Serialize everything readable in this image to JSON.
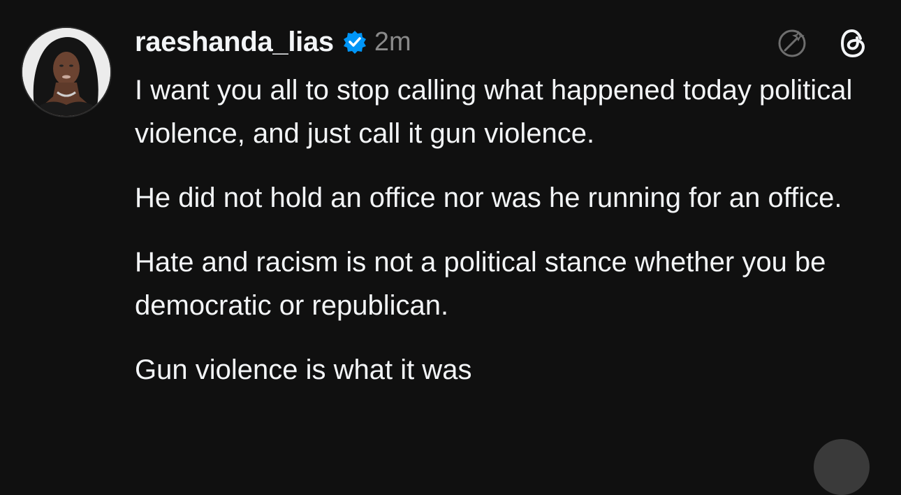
{
  "post": {
    "username": "raeshanda_lias",
    "timestamp": "2m",
    "verified_icon": "verified-badge-icon",
    "paragraphs": [
      "I want you all to stop calling what happened today political violence, and just call it gun violence.",
      "He did not hold an office nor was he running for an office.",
      "Hate and racism is not a political stance whether you be democratic or republican.",
      "Gun violence is what it was"
    ]
  },
  "icons": {
    "ai": "ai-edit-icon",
    "threads": "threads-logo-icon"
  },
  "colors": {
    "background": "#101010",
    "text": "#f3f5f7",
    "muted": "#8a8a8a",
    "verified": "#0095f6"
  }
}
